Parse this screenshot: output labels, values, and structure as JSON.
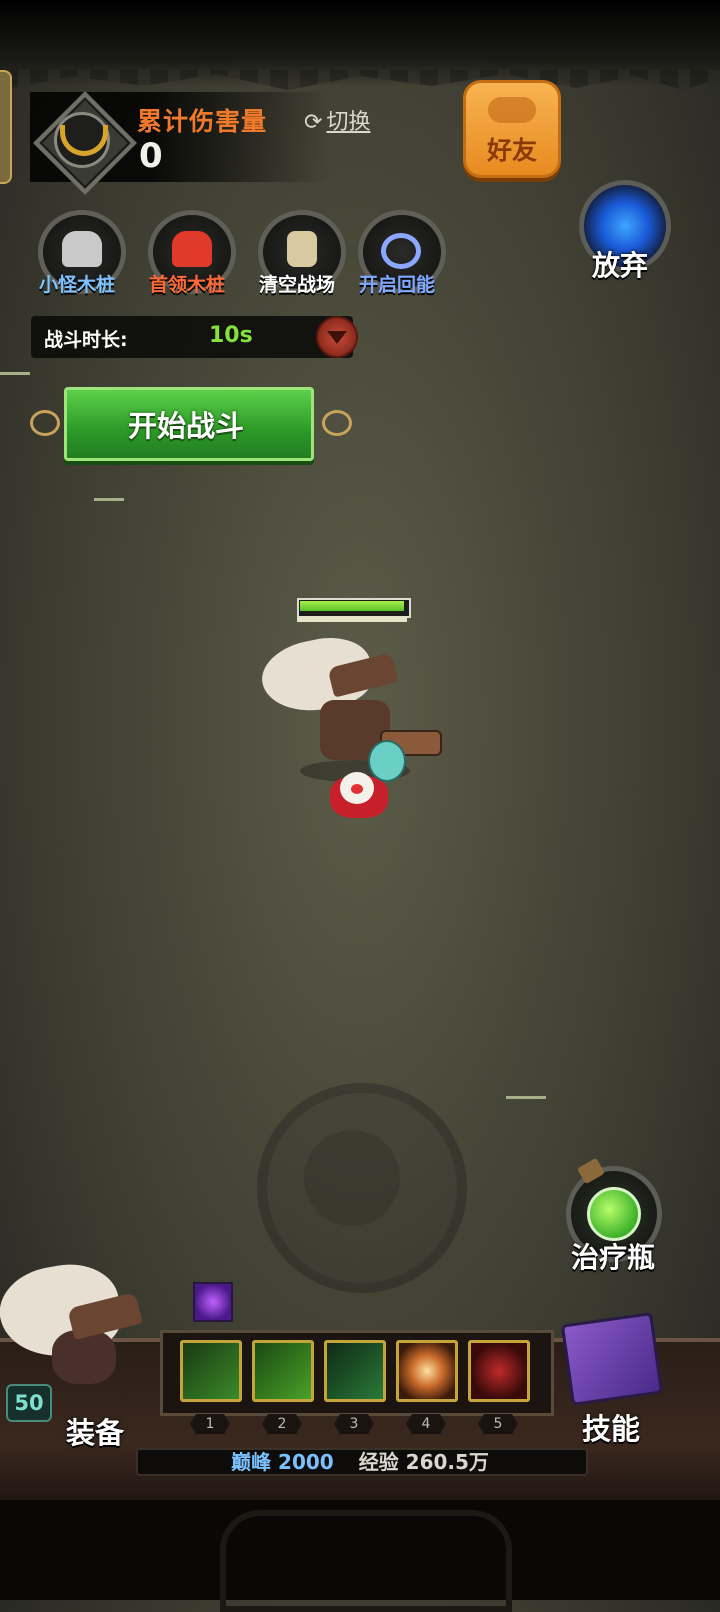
{
  "header": {
    "damage_title": "累计伤害量",
    "damage_value": "0",
    "switch_label": "切换",
    "friend_label": "好友",
    "abandon_label": "放弃"
  },
  "tools": [
    {
      "label": "小怪木桩",
      "color": "#7fc4ff",
      "glyph_color": "#c9c9c9"
    },
    {
      "label": "首领木桩",
      "color": "#ff6a3a",
      "glyph_color": "#e03a2a"
    },
    {
      "label": "清空战场",
      "color": "#ffffff",
      "glyph_color": "#d9c9a0"
    },
    {
      "label": "开启回能",
      "color": "#7fa8ff",
      "glyph_color": "#8aa8ff"
    }
  ],
  "duration": {
    "label": "战斗时长:",
    "value": "10s"
  },
  "start_button": "开始战斗",
  "player": {
    "hp_fraction": 1.0
  },
  "potion_label": "治疗瓶",
  "bottom": {
    "level": "50",
    "equip_label": "装备",
    "skills_label": "技能",
    "skills": [
      {
        "num": "1",
        "color": "#3a8a2a"
      },
      {
        "num": "2",
        "color": "#4aa02a"
      },
      {
        "num": "3",
        "color": "#2a7a3a"
      },
      {
        "num": "4",
        "color": "#c86a2a"
      },
      {
        "num": "5",
        "color": "#6a1a1a"
      }
    ],
    "peak_key": "巅峰",
    "peak_value": "2000",
    "exp_key": "经验",
    "exp_value": "260.5万"
  }
}
